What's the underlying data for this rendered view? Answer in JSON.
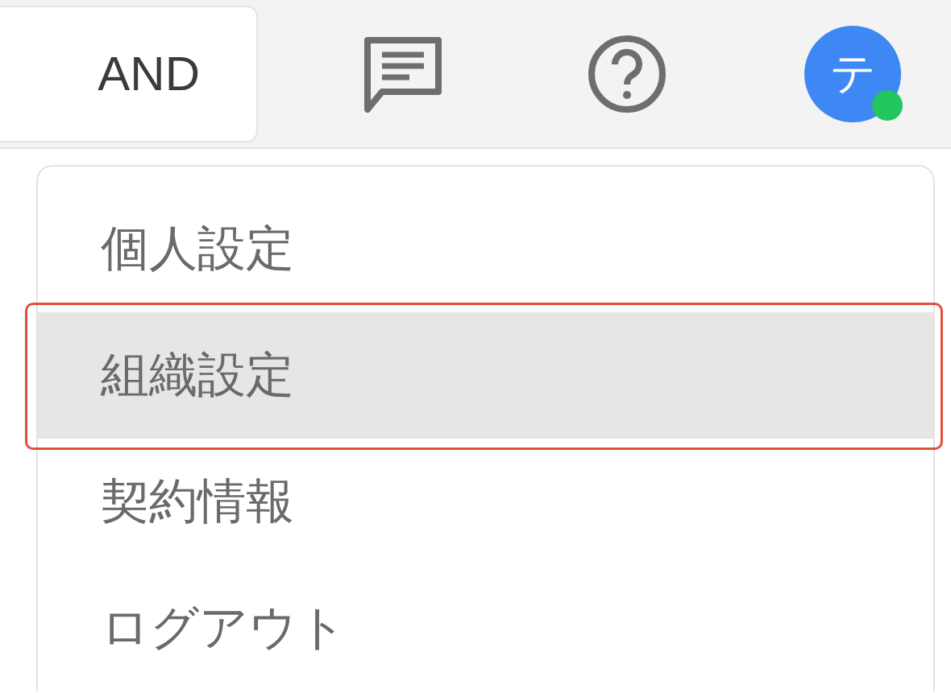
{
  "header": {
    "search_mode": "AND",
    "avatar_initial": "テ",
    "online": true
  },
  "menu": {
    "items": [
      {
        "label": "個人設定",
        "selected": false,
        "annotated": false
      },
      {
        "label": "組織設定",
        "selected": true,
        "annotated": true
      },
      {
        "label": "契約情報",
        "selected": false,
        "annotated": false
      },
      {
        "label": "ログアウト",
        "selected": false,
        "annotated": false
      }
    ]
  }
}
